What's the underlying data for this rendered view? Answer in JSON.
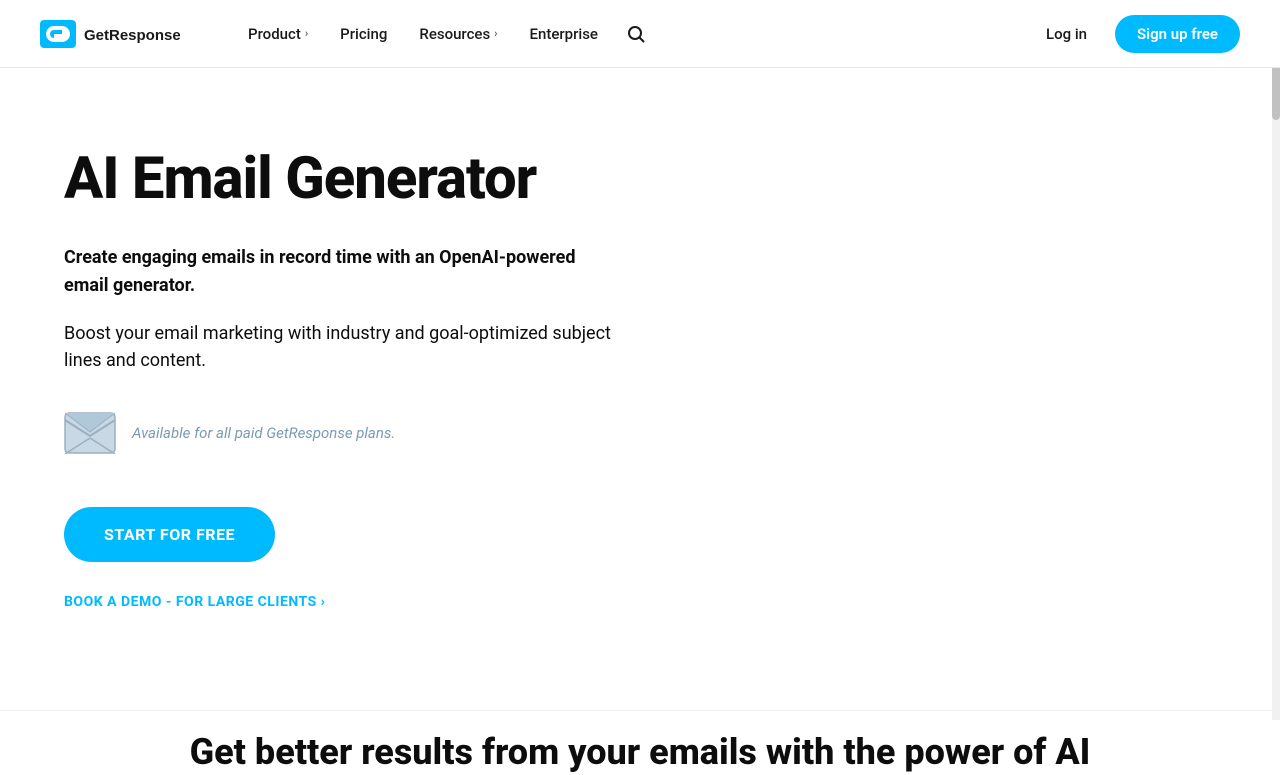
{
  "nav": {
    "logo_alt": "GetResponse",
    "items": [
      {
        "label": "Product",
        "has_chevron": true,
        "id": "product"
      },
      {
        "label": "Pricing",
        "has_chevron": false,
        "id": "pricing"
      },
      {
        "label": "Resources",
        "has_chevron": true,
        "id": "resources"
      },
      {
        "label": "Enterprise",
        "has_chevron": false,
        "id": "enterprise"
      }
    ],
    "login_label": "Log in",
    "signup_label": "Sign up free"
  },
  "hero": {
    "title": "AI Email Generator",
    "subtitle_bold": "Create engaging emails in record time with an OpenAI-powered email generator.",
    "subtitle_regular": "Boost your email marketing with industry and goal-optimized subject lines and content.",
    "availability_text": "Available for all paid GetResponse plans.",
    "cta_primary": "START FOR FREE",
    "cta_secondary": "BOOK A DEMO - FOR LARGE CLIENTS ›"
  },
  "bottom": {
    "title": "Get better results from your emails with the power of AI"
  },
  "colors": {
    "accent": "#00baff",
    "text_dark": "#0d0d0d",
    "text_muted": "#7a9bb5"
  }
}
